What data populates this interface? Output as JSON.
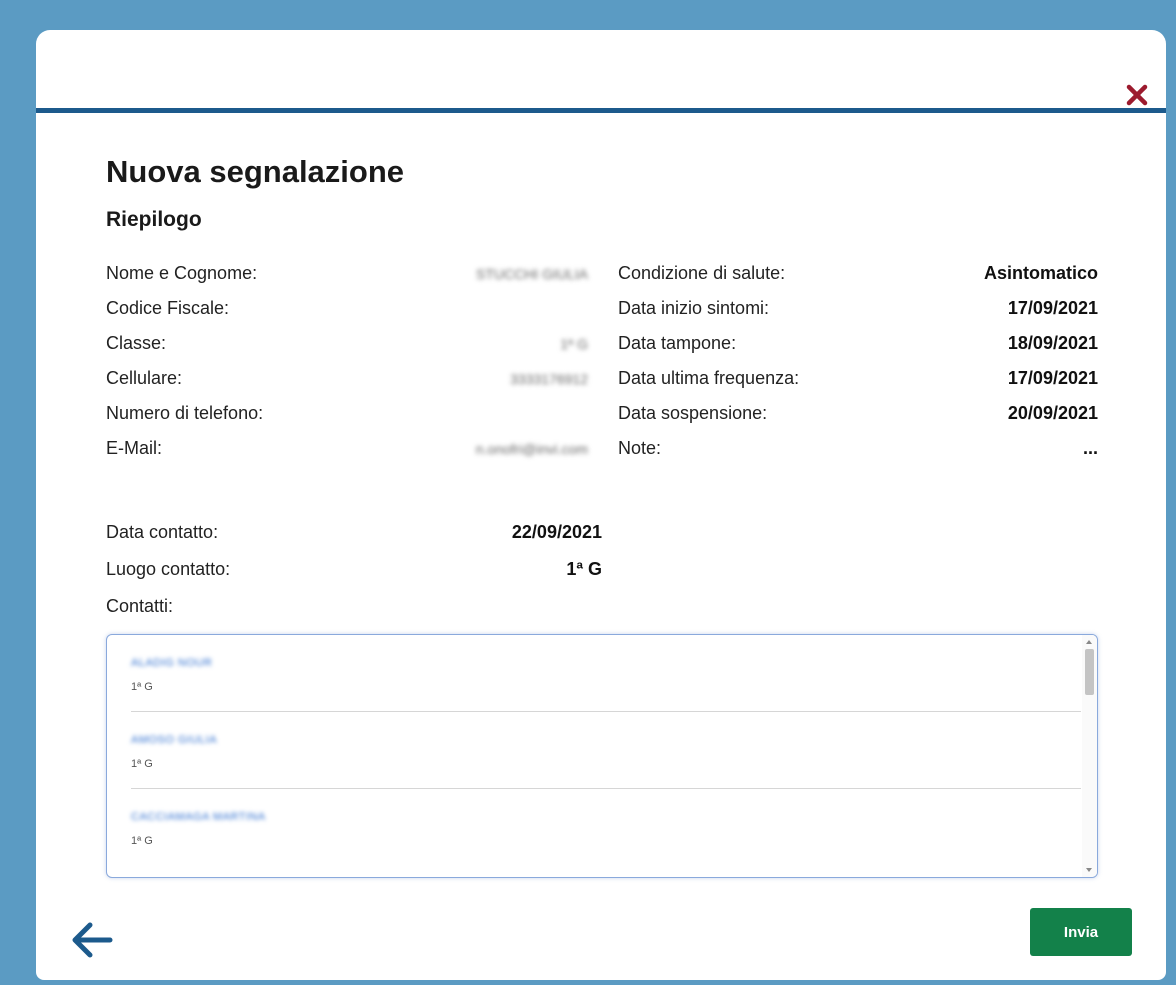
{
  "modal": {
    "title": "Nuova segnalazione",
    "subtitle": "Riepilogo",
    "close_icon": "close-icon",
    "accent_color": "#1c5a8c",
    "close_color": "#9c1b2e"
  },
  "student": [
    {
      "label": "Nome e Cognome:",
      "value": "STUCCHI GIULIA"
    },
    {
      "label": "Codice Fiscale:",
      "value": ""
    },
    {
      "label": "Classe:",
      "value": "1ª G"
    },
    {
      "label": "Cellulare:",
      "value": "3333176912"
    },
    {
      "label": "Numero di telefono:",
      "value": ""
    },
    {
      "label": "E-Mail:",
      "value": "n.onofri@invi.com"
    }
  ],
  "health": [
    {
      "label": "Condizione di salute:",
      "value": "Asintomatico"
    },
    {
      "label": "Data inizio sintomi:",
      "value": "17/09/2021"
    },
    {
      "label": "Data tampone:",
      "value": "18/09/2021"
    },
    {
      "label": "Data ultima frequenza:",
      "value": "17/09/2021"
    },
    {
      "label": "Data sospensione:",
      "value": "20/09/2021"
    },
    {
      "label": "Note:",
      "value": "..."
    }
  ],
  "contact": {
    "date_label": "Data contatto:",
    "date_value": "22/09/2021",
    "place_label": "Luogo contatto:",
    "place_value": "1ª G",
    "contacts_label": "Contatti:"
  },
  "contacts_list": [
    {
      "name": "ALADIG NOUR",
      "class": "1ª G"
    },
    {
      "name": "AMOSO GIULIA",
      "class": "1ª G"
    },
    {
      "name": "CACCIAMAGA MARTINA",
      "class": "1ª G"
    }
  ],
  "footer": {
    "back_icon": "arrow-left-icon",
    "send_label": "Invia",
    "send_color": "#13814a"
  }
}
